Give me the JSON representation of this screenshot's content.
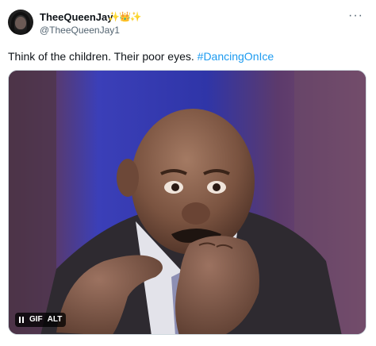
{
  "tweet": {
    "display_name": "TheeQueenJay",
    "badges": "✨👑✨",
    "handle": "@TheeQueenJay1",
    "more_glyph": "···",
    "text_plain": "Think of the children. Their poor eyes. ",
    "hashtag": "#DancingOnIce"
  },
  "media": {
    "gif_label": "GIF",
    "alt_label": "ALT",
    "pause_icon": "pause-icon"
  },
  "colors": {
    "hashtag": "#1d9bf0",
    "secondary_text": "#536471",
    "primary_text": "#0f1419"
  }
}
